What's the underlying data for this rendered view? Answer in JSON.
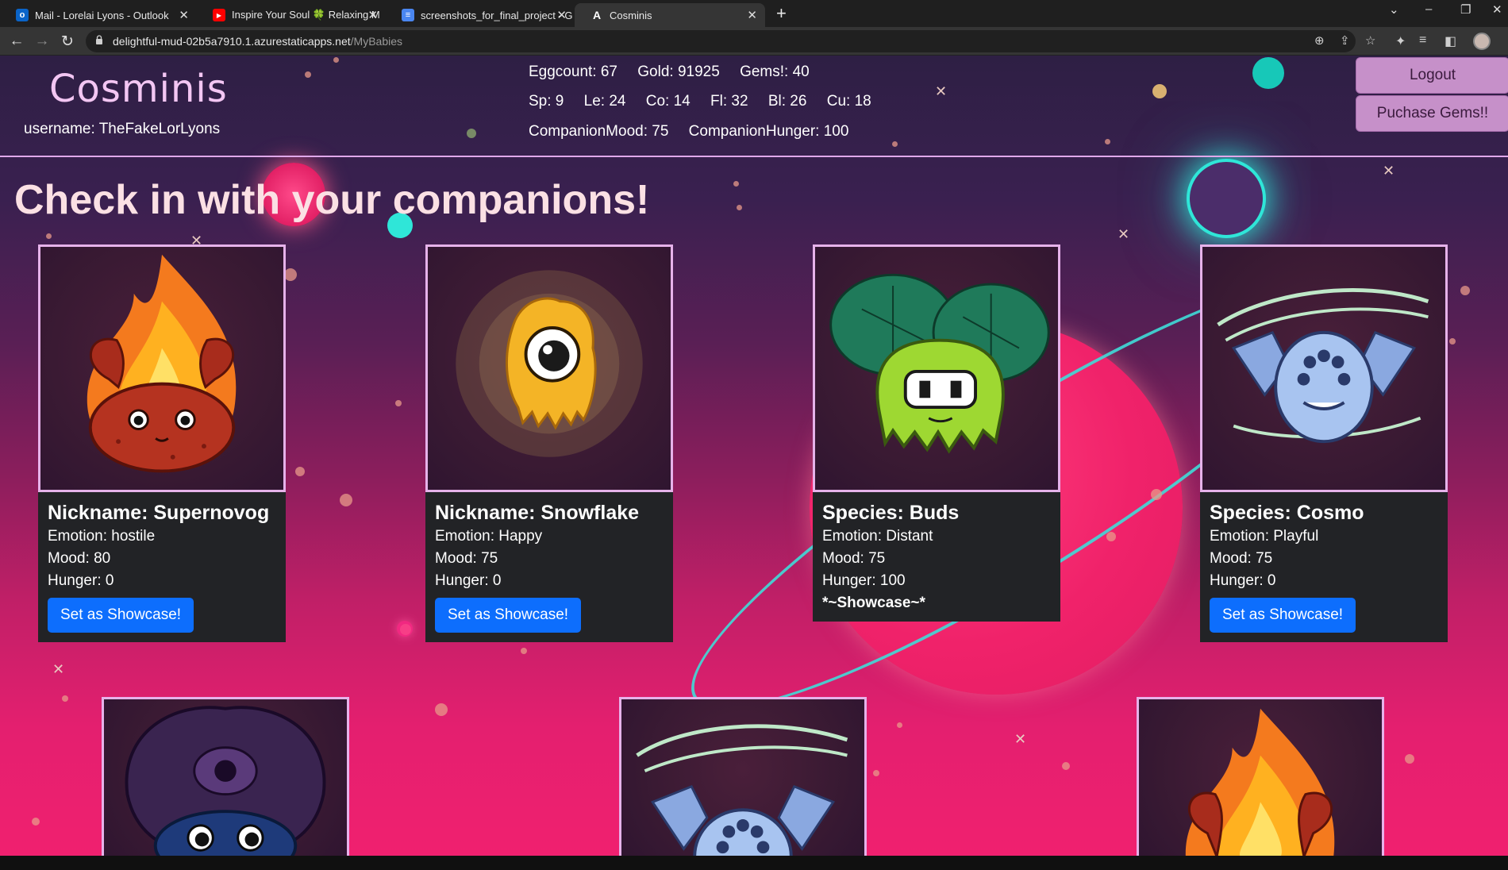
{
  "browser": {
    "tabs": [
      {
        "label": "Mail - Lorelai Lyons - Outlook",
        "icon": "outlook-icon",
        "active": false
      },
      {
        "label": "Inspire Your Soul 🍀 Relaxing M",
        "icon": "youtube-icon",
        "active": false
      },
      {
        "label": "screenshots_for_final_project - G",
        "icon": "docs-icon",
        "active": false
      },
      {
        "label": "Cosminis",
        "icon": "app-favicon-icon",
        "active": true
      }
    ],
    "url_host": "delightful-mud-02b5a7910.1.azurestaticapps.net",
    "url_path": "/MyBabies"
  },
  "header": {
    "logo": "Cosminis",
    "username": "username: TheFakeLorLyons",
    "stats_row1": [
      "Eggcount: 67",
      "Gold: 91925",
      "Gems!: 40"
    ],
    "stats_row2": [
      "Sp: 9",
      "Le: 24",
      "Co: 14",
      "Fl: 32",
      "Bl: 26",
      "Cu: 18"
    ],
    "stats_row3": [
      "CompanionMood: 75",
      "CompanionHunger: 100"
    ],
    "logout_label": "Logout",
    "gems_label": "Puchase Gems!!"
  },
  "page": {
    "title": "Check in with your companions!"
  },
  "companions": [
    {
      "title": "Nickname: Supernovog",
      "emotion": "Emotion: hostile",
      "mood": "Mood: 80",
      "hunger": "Hunger: 0",
      "action": "Set as Showcase!",
      "art": "fire-crab"
    },
    {
      "title": "Nickname: Snowflake",
      "emotion": "Emotion: Happy",
      "mood": "Mood: 75",
      "hunger": "Hunger: 0",
      "action": "Set as Showcase!",
      "art": "yellow-fuzzball"
    },
    {
      "title": "Species: Buds",
      "emotion": "Emotion: Distant",
      "mood": "Mood: 75",
      "hunger": "Hunger: 100",
      "showcase": "*~Showcase~*",
      "art": "green-slime"
    },
    {
      "title": "Species: Cosmo",
      "emotion": "Emotion: Playful",
      "mood": "Mood: 75",
      "hunger": "Hunger: 0",
      "action": "Set as Showcase!",
      "art": "blue-wind-spirit"
    }
  ],
  "colors": {
    "accent_button": "#0d6efd",
    "header_button": "#c690c9",
    "card_body": "#222326",
    "card_border": "#e6b2ea",
    "logo": "#f3c6f3"
  }
}
